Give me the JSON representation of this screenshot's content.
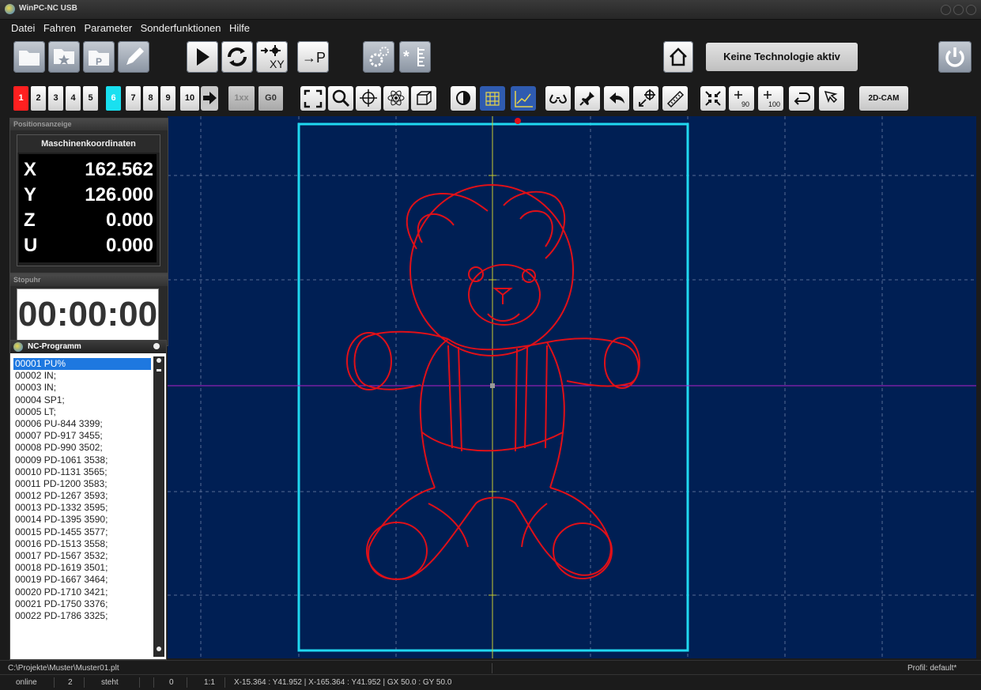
{
  "window": {
    "title": "WinPC-NC USB"
  },
  "menu": [
    "Datei",
    "Fahren",
    "Parameter",
    "Sonderfunktionen",
    "Hilfe"
  ],
  "toolbar": {
    "technology_label": "Keine Technologie aktiv",
    "goto_p_label": "→P",
    "xy_label": "XY"
  },
  "layers": [
    "1",
    "2",
    "3",
    "4",
    "5",
    "6",
    "7",
    "8",
    "9",
    "10"
  ],
  "layer_active": [
    "1",
    "6"
  ],
  "toolbar2": {
    "btn_1xx": "1xx",
    "btn_g0": "G0",
    "cam_label": "2D-CAM",
    "zoom90": "90",
    "zoom100": "100"
  },
  "position_panel": {
    "title": "Positionsanzeige",
    "caption": "Maschinenkoordinaten",
    "axes": [
      {
        "label": "X",
        "value": "162.562"
      },
      {
        "label": "Y",
        "value": "126.000"
      },
      {
        "label": "Z",
        "value": "0.000"
      },
      {
        "label": "U",
        "value": "0.000"
      }
    ]
  },
  "stopwatch": {
    "title": "Stopuhr",
    "time": "00:00:00"
  },
  "nc_program": {
    "title": "NC-Programm",
    "lines": [
      "00001  PU%",
      "00002  IN;",
      "00003  IN;",
      "00004  SP1;",
      "00005  LT;",
      "00006  PU-844 3399;",
      "00007  PD-917 3455;",
      "00008  PD-990 3502;",
      "00009  PD-1061 3538;",
      "00010  PD-1131 3565;",
      "00011  PD-1200 3583;",
      "00012  PD-1267 3593;",
      "00013  PD-1332 3595;",
      "00014  PD-1395 3590;",
      "00015  PD-1455 3577;",
      "00016  PD-1513 3558;",
      "00017  PD-1567 3532;",
      "00018  PD-1619 3501;",
      "00019  PD-1667 3464;",
      "00020  PD-1710 3421;",
      "00021  PD-1750 3376;",
      "00022  PD-1786 3325;"
    ]
  },
  "status": {
    "file_path": "C:\\Projekte\\Muster\\Muster01.plt",
    "profile": "Profil: default*",
    "online": "online",
    "count": "2",
    "state": "steht",
    "zero": "0",
    "scale": "1:1",
    "coords": "X-15.364 : Y41.952  |  X-165.364 : Y41.952  |  GX 50.0 : GY 50.0"
  },
  "colors": {
    "canvas_bg": "#001f54",
    "workpiece_border": "#20d8f0",
    "drawing": "#e01018",
    "crosshair_v": "#c8c832",
    "crosshair_h": "#b020c8",
    "layer1": "#ff2020",
    "layer6": "#19e0f0"
  }
}
